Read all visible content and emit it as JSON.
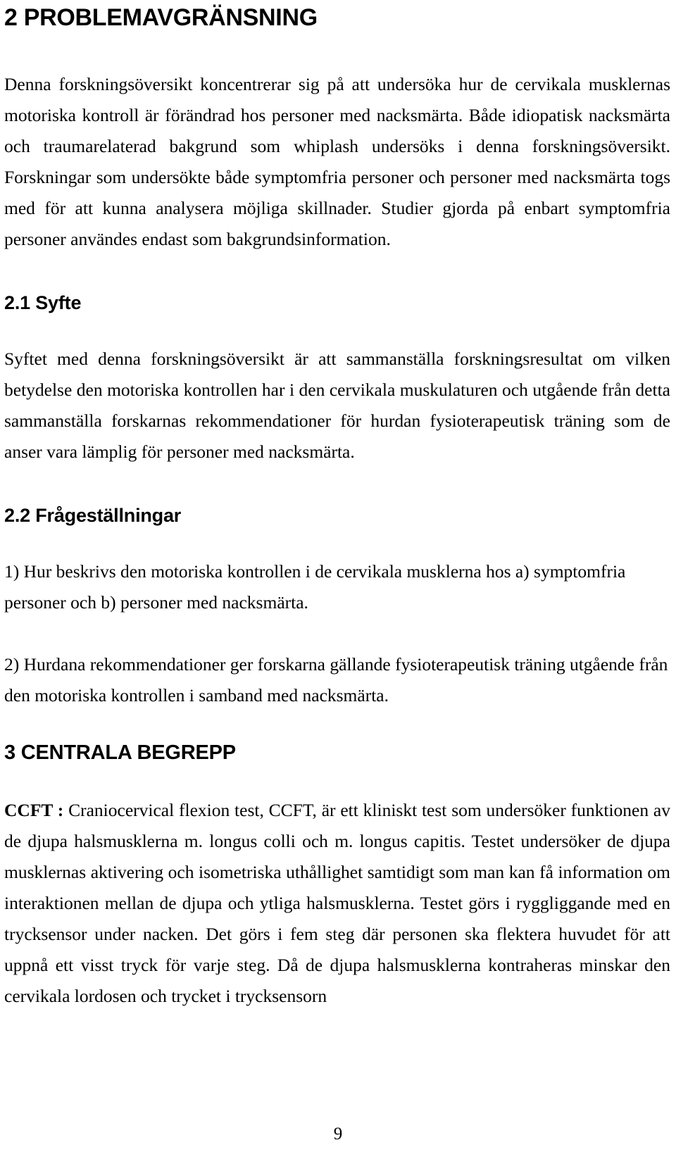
{
  "document": {
    "page_number": "9",
    "language": "sv"
  },
  "chapter2": {
    "heading": "2 PROBLEMAVGRÄNSNING",
    "intro_paragraph": "Denna forskningsöversikt koncentrerar sig på att undersöka hur de cervikala musklernas motoriska kontroll är förändrad hos personer med nacksmärta. Både idiopatisk nacksmärta och traumarelaterad bakgrund som whiplash undersöks i denna forskningsöversikt. Forskningar som undersökte både symptomfria personer och personer med nacksmärta togs med för att kunna analysera möjliga skillnader. Studier gjorda på enbart symptomfria personer användes endast som bakgrundsinformation."
  },
  "section21": {
    "heading": "2.1 Syfte",
    "paragraph": "Syftet med denna forskningsöversikt är att sammanställa forskningsresultat om vilken betydelse den motoriska kontrollen har i den cervikala muskulaturen och utgående från detta sammanställa forskarnas rekommendationer för hurdan fysioterapeutisk träning som de anser vara lämplig för personer med nacksmärta."
  },
  "section22": {
    "heading": "2.2 Frågeställningar",
    "question1": "1) Hur beskrivs den motoriska kontrollen i de cervikala musklerna hos a) symptomfria personer och b) personer med nacksmärta.",
    "question2": "2) Hurdana rekommendationer ger forskarna gällande fysioterapeutisk träning utgående från den motoriska kontrollen i samband med nacksmärta."
  },
  "chapter3": {
    "heading": "3 CENTRALA BEGREPP",
    "term_ccft_label": "CCFT :",
    "term_ccft_definition": "Craniocervical flexion test, CCFT, är ett kliniskt test som undersöker funktionen av de djupa halsmusklerna m. longus colli och m. longus capitis. Testet undersöker de djupa musklernas aktivering och isometriska uthållighet samtidigt som man kan få information om interaktionen mellan de djupa och ytliga halsmusklerna. Testet görs i ryggliggande med en trycksensor under nacken. Det görs i fem steg där personen ska flektera huvudet för att uppnå ett visst tryck för varje steg. Då de djupa halsmusklerna kontraheras minskar den cervikala lordosen och trycket i trycksensorn"
  }
}
